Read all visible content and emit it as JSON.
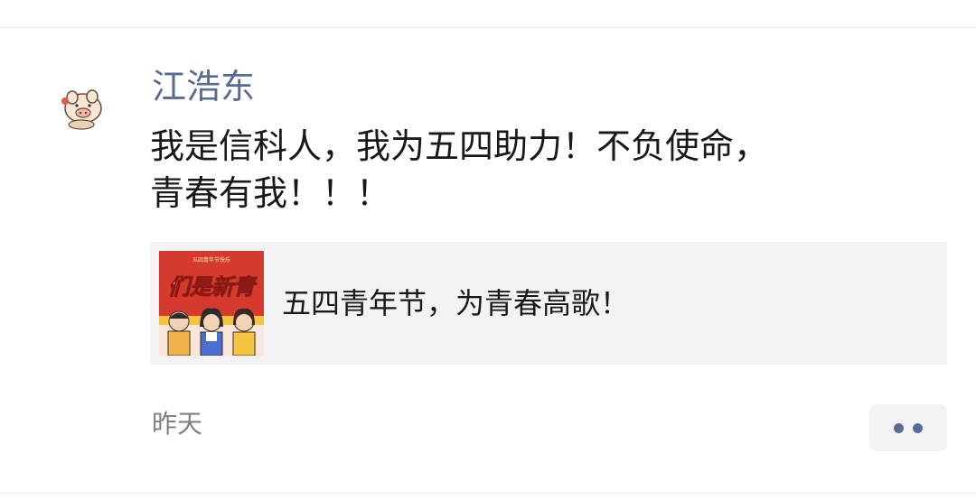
{
  "post": {
    "author": "江浩东",
    "text": "我是信科人，我为五四助力！不负使命，\n青春有我！！！",
    "timestamp": "昨天"
  },
  "link_card": {
    "title": "五四青年节，为青春高歌！",
    "thumbnail_banner_text": "们是新青",
    "thumbnail_top_text": "五四青年节快乐"
  },
  "colors": {
    "author_name": "#576b95",
    "body_text": "#191919",
    "timestamp": "#7f7f7f",
    "card_background": "#f3f3f5",
    "more_dots": "#576b95",
    "thumbnail_red": "#d63a2f",
    "thumbnail_yellow": "#f5c542"
  },
  "icons": {
    "avatar": "cartoon-pig-avatar",
    "more": "more-dots-icon"
  }
}
